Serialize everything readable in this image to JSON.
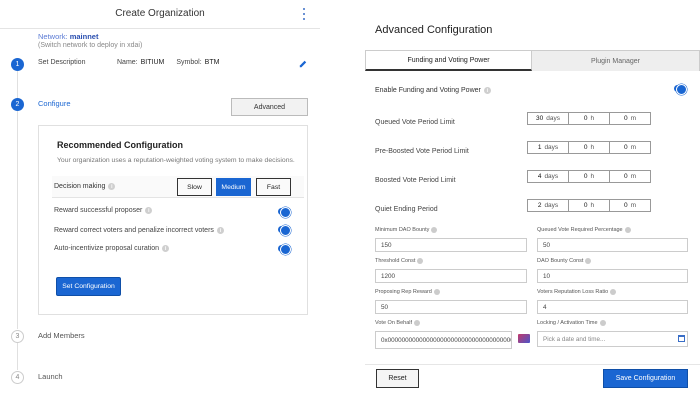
{
  "left": {
    "title": "Create Organization",
    "network_label": "Network:",
    "network_value": "mainnet",
    "network_hint": "(Switch network to deploy in xdai)",
    "steps": [
      {
        "num": "1",
        "label": "Set Description"
      },
      {
        "num": "2",
        "label": "Configure"
      },
      {
        "num": "3",
        "label": "Add Members"
      },
      {
        "num": "4",
        "label": "Launch"
      }
    ],
    "description": {
      "name_label": "Name:",
      "name_value": "BITIUM",
      "symbol_label": "Symbol:",
      "symbol_value": "BTM"
    },
    "advanced_label": "Advanced",
    "recommended": {
      "title": "Recommended Configuration",
      "subtitle": "Your organization uses a reputation-weighted voting system to make decisions.",
      "decision_label": "Decision making",
      "options": [
        "Slow",
        "Medium",
        "Fast"
      ],
      "selected": "Medium",
      "toggles": [
        {
          "label": "Reward successful proposer",
          "on": true
        },
        {
          "label": "Reward correct voters and penalize incorrect voters",
          "on": true
        },
        {
          "label": "Auto-incentivize proposal curation",
          "on": true
        }
      ],
      "set_button": "Set Configuration"
    }
  },
  "right": {
    "title": "Advanced Configuration",
    "tabs": [
      "Funding and Voting Power",
      "Plugin Manager"
    ],
    "active_tab": "Funding and Voting Power",
    "enable_label": "Enable Funding and Voting Power",
    "enable_on": true,
    "periods": [
      {
        "label": "Queued Vote Period Limit",
        "days": "30",
        "hours": "0",
        "minutes": "0"
      },
      {
        "label": "Pre-Boosted Vote Period Limit",
        "days": "1",
        "hours": "0",
        "minutes": "0"
      },
      {
        "label": "Boosted Vote Period Limit",
        "days": "4",
        "hours": "0",
        "minutes": "0"
      },
      {
        "label": "Quiet Ending Period",
        "days": "2",
        "hours": "0",
        "minutes": "0"
      }
    ],
    "units": {
      "days": "days",
      "hours": "h",
      "minutes": "m"
    },
    "fields": [
      {
        "label": "Minimum DAO Bounty",
        "value": "150"
      },
      {
        "label": "Queued Vote Required Percentage",
        "value": "50"
      },
      {
        "label": "Threshold Const",
        "value": "1200"
      },
      {
        "label": "DAO Bounty Const",
        "value": "10"
      },
      {
        "label": "Proposing Rep Reward",
        "value": "50"
      },
      {
        "label": "Voters Reputation Loss Ratio",
        "value": "4"
      },
      {
        "label": "Vote On Behalf",
        "value": "0x0000000000000000000000000000000000000000"
      },
      {
        "label": "Locking / Activation Time",
        "placeholder": "Pick a date and time..."
      }
    ],
    "reset_label": "Reset",
    "save_label": "Save Configuration"
  },
  "colors": {
    "accent": "#1a66d2",
    "network": "#5b7bd5"
  }
}
